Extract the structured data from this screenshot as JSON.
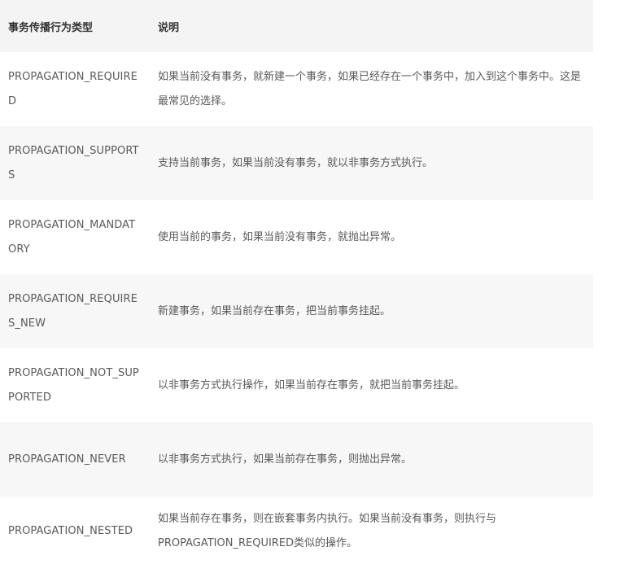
{
  "table": {
    "headers": [
      "事务传播行为类型",
      "说明"
    ],
    "rows": [
      {
        "type": "PROPAGATION_REQUIRED",
        "desc": "如果当前没有事务，就新建一个事务，如果已经存在一个事务中，加入到这个事务中。这是最常见的选择。"
      },
      {
        "type": "PROPAGATION_SUPPORTS",
        "desc": "支持当前事务，如果当前没有事务，就以非事务方式执行。"
      },
      {
        "type": "PROPAGATION_MANDATORY",
        "desc": "使用当前的事务，如果当前没有事务，就抛出异常。"
      },
      {
        "type": "PROPAGATION_REQUIRES_NEW",
        "desc": "新建事务，如果当前存在事务，把当前事务挂起。"
      },
      {
        "type": "PROPAGATION_NOT_SUPPORTED",
        "desc": "以非事务方式执行操作，如果当前存在事务，就把当前事务挂起。"
      },
      {
        "type": "PROPAGATION_NEVER",
        "desc": "以非事务方式执行，如果当前存在事务，则抛出异常。"
      },
      {
        "type": "PROPAGATION_NESTED",
        "desc": "如果当前存在事务，则在嵌套事务内执行。如果当前没有事务，则执行与PROPAGATION_REQUIRED类似的操作。"
      }
    ]
  }
}
